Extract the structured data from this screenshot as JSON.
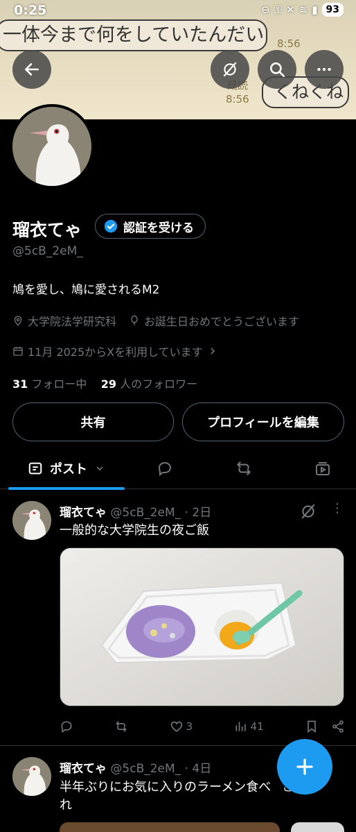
{
  "status_bar": {
    "time": "0:25",
    "battery": "93"
  },
  "banner": {
    "bubble_1": "一体今まで何をしていたんだい",
    "bubble_2": "くねくね",
    "time_1": "8:56",
    "read_label": "既読",
    "time_2": "8:56"
  },
  "profile": {
    "name": "瑠衣てゃ",
    "verify_label": "認証を受ける",
    "handle": "@5cB_2eM_",
    "bio": "鳩を愛し、鳩に愛されるM2",
    "location": "大学院法学研究科",
    "birthday": "お誕生日おめでとうございます",
    "joined": "11月 2025からXを利用しています",
    "following_count": "31",
    "following_label": "フォロー中",
    "followers_count": "29",
    "followers_label": "人のフォロワー"
  },
  "buttons": {
    "share": "共有",
    "edit_profile": "プロフィールを編集"
  },
  "tabs": {
    "posts": "ポスト"
  },
  "posts": [
    {
      "name": "瑠衣てゃ",
      "handle": "@5cB_2eM_",
      "time": "· 2日",
      "text": "一般的な大学院生の夜ご飯",
      "likes": "3",
      "views": "41"
    },
    {
      "name": "瑠衣てゃ",
      "handle": "@5cB_2eM_",
      "time": "· 4日",
      "text": "半年ぶりにお気に入りのラーメン食べ",
      "text_tail": "こ",
      "text_line2": "れ"
    }
  ],
  "colors": {
    "accent": "#1d9bf0",
    "background": "#000000",
    "muted": "#71767b"
  },
  "icons": [
    "back-arrow-icon",
    "grok-icon",
    "search-icon",
    "more-icon",
    "verified-badge-icon",
    "location-icon",
    "balloon-icon",
    "calendar-icon",
    "chevron-right-icon",
    "reply-icon",
    "repost-icon",
    "like-icon",
    "views-icon",
    "bookmark-icon",
    "share-icon",
    "plus-icon"
  ]
}
